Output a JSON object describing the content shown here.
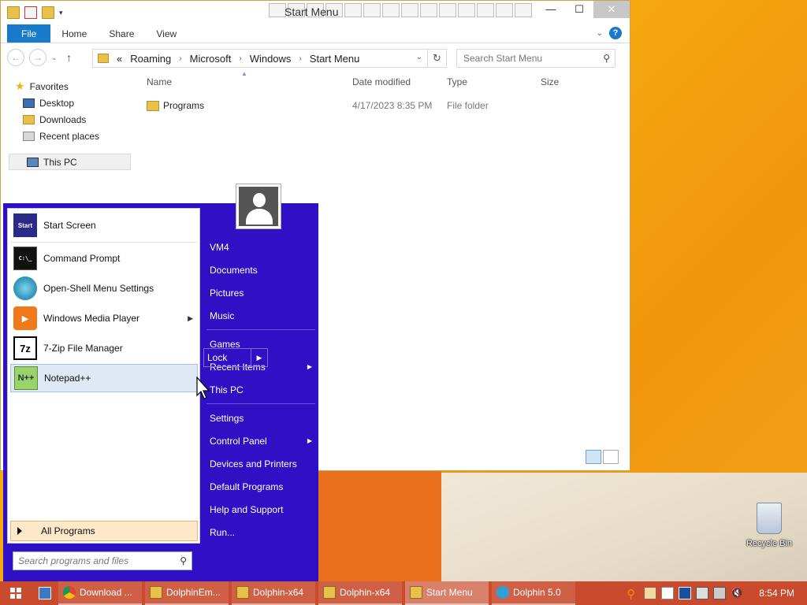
{
  "explorer": {
    "title": "Start Menu",
    "ribbon_tabs": [
      "File",
      "Home",
      "Share",
      "View"
    ],
    "address_prefix": "«",
    "address_segments": [
      "Roaming",
      "Microsoft",
      "Windows",
      "Start Menu"
    ],
    "search_placeholder": "Search Start Menu",
    "nav": {
      "favorites": "Favorites",
      "desktop": "Desktop",
      "downloads": "Downloads",
      "recent": "Recent places",
      "thispc": "This PC"
    },
    "columns": {
      "name": "Name",
      "date": "Date modified",
      "type": "Type",
      "size": "Size"
    },
    "files": [
      {
        "name": "Programs",
        "date": "4/17/2023 8:35 PM",
        "type": "File folder"
      }
    ]
  },
  "startmenu": {
    "left_items": [
      {
        "label": "Start Screen",
        "icon": "start-screen-icon"
      },
      {
        "label": "Command Prompt",
        "icon": "cmd-icon"
      },
      {
        "label": "Open-Shell Menu Settings",
        "icon": "shell-icon"
      },
      {
        "label": "Windows Media Player",
        "icon": "wmp-icon"
      },
      {
        "label": "7-Zip File Manager",
        "icon": "7zip-icon"
      },
      {
        "label": "Notepad++",
        "icon": "notepadpp-icon"
      }
    ],
    "icon_text": {
      "start": "Start",
      "cmd": "C:\\_",
      "sevenzip": "7z",
      "npp": "N++"
    },
    "all_programs": "All Programs",
    "search_placeholder": "Search programs and files",
    "right_items": {
      "vm4": "VM4",
      "documents": "Documents",
      "pictures": "Pictures",
      "music": "Music",
      "games": "Games",
      "recent": "Recent Items",
      "thispc": "This PC",
      "settings": "Settings",
      "control": "Control Panel",
      "devices": "Devices and Printers",
      "default": "Default Programs",
      "help": "Help and Support",
      "run": "Run..."
    },
    "lock": "Lock"
  },
  "desktop": {
    "recycle_bin": "Recycle Bin"
  },
  "taskbar": {
    "tasks": [
      {
        "label": "Download ...",
        "icon": "chrome-icon"
      },
      {
        "label": "DolphinEm...",
        "icon": "folder-icon"
      },
      {
        "label": "Dolphin-x64",
        "icon": "folder-icon"
      },
      {
        "label": "Dolphin-x64",
        "icon": "folder-icon"
      },
      {
        "label": "Start Menu",
        "icon": "folder-icon"
      },
      {
        "label": "Dolphin 5.0",
        "icon": "dolphin-icon"
      }
    ],
    "clock": "8:54 PM"
  },
  "colors": {
    "start_menu_bg": "#2f10c4",
    "taskbar_bg": "#c94a2c",
    "file_tab": "#1979ca"
  }
}
